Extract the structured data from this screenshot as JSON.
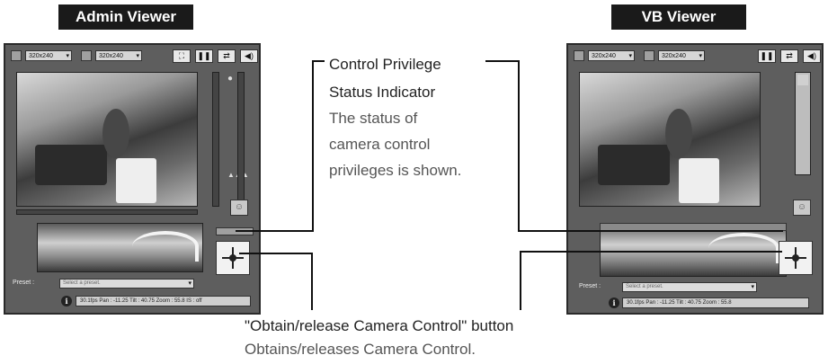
{
  "admin": {
    "title": "Admin Viewer",
    "size1": "320x240",
    "size2": "320x240",
    "buttons": [
      "⛶",
      "❚❚",
      "⇄",
      "◀)"
    ],
    "preset_label": "Preset :",
    "preset_placeholder": "Select a preset.",
    "info": "30.1fps Pan : -11.25 Tilt : 40.75 Zoom : 55.8 IS : off"
  },
  "vb": {
    "title": "VB Viewer",
    "size1": "320x240",
    "size2": "320x240",
    "buttons": [
      "❚❚",
      "⇄",
      "◀)"
    ],
    "preset_label": "Preset :",
    "preset_placeholder": "Select a preset.",
    "info": "30.1fps Pan : -11.25 Tilt : 40.75 Zoom : 55.8"
  },
  "callouts": {
    "status_title_1": "Control Privilege",
    "status_title_2": "Status Indicator",
    "status_desc": [
      "The status of",
      "camera control",
      "privileges is shown."
    ],
    "button_title": "\"Obtain/release Camera Control\" button",
    "button_desc": "Obtains/releases Camera Control."
  },
  "icons": {
    "control": "crosshair-icon",
    "info": "info-icon",
    "person": "person-icon"
  }
}
